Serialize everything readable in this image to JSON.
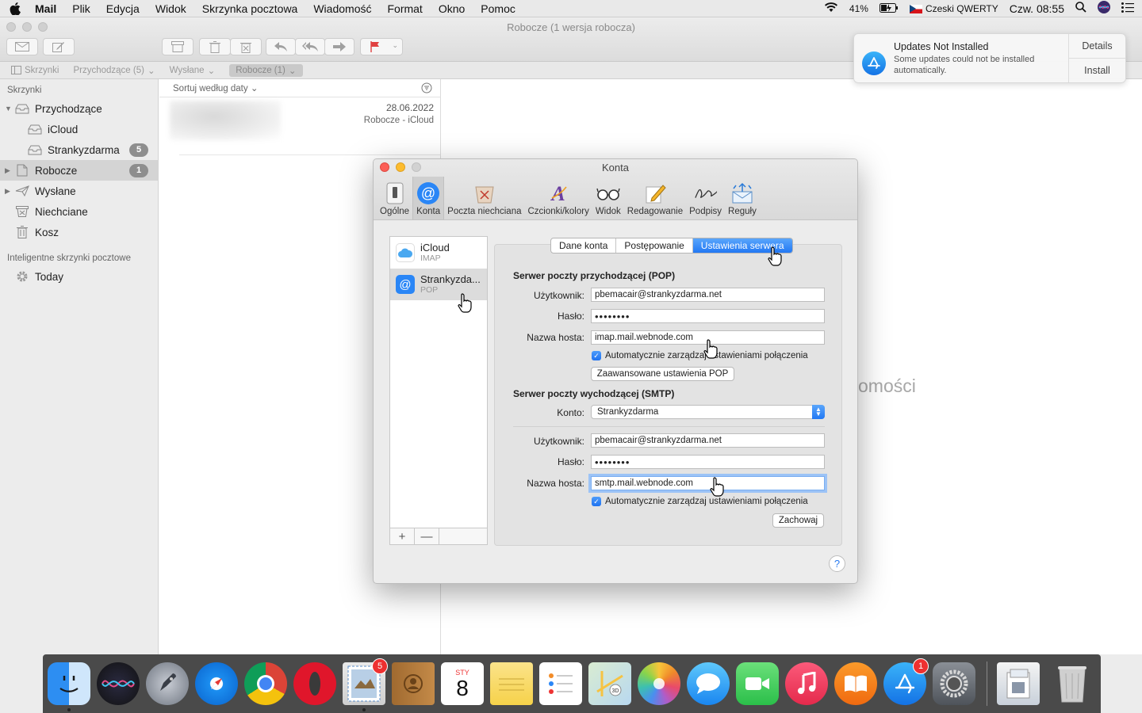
{
  "menubar": {
    "app": "Mail",
    "items": [
      "Plik",
      "Edycja",
      "Widok",
      "Skrzynka pocztowa",
      "Wiadomość",
      "Format",
      "Okno",
      "Pomoc"
    ],
    "battery": "41%",
    "input_source": "Czeski QWERTY",
    "clock": "Czw. 08:55"
  },
  "window": {
    "title": "Robocze (1 wersja robocza)"
  },
  "favorites": {
    "mailboxes": "Skrzynki",
    "inbox": "Przychodzące (5)",
    "sent": "Wysłane",
    "drafts": "Robocze (1)"
  },
  "sidebar": {
    "heading": "Skrzynki",
    "items": [
      {
        "label": "Przychodzące",
        "badge": ""
      },
      {
        "label": "iCloud",
        "badge": ""
      },
      {
        "label": "Strankyzdarma",
        "badge": "5"
      },
      {
        "label": "Robocze",
        "badge": "1"
      },
      {
        "label": "Wysłane",
        "badge": ""
      },
      {
        "label": "Niechciane",
        "badge": ""
      },
      {
        "label": "Kosz",
        "badge": ""
      }
    ],
    "smart_heading": "Inteligentne skrzynki pocztowe",
    "smart_items": [
      {
        "label": "Today"
      }
    ]
  },
  "message_list": {
    "sort_label": "Sortuj według daty",
    "messages": [
      {
        "date": "28.06.2022",
        "account": "Robocze - iCloud"
      }
    ]
  },
  "preview_hint": "omości",
  "notification": {
    "title": "Updates Not Installed",
    "text": "Some updates could not be installed automatically.",
    "details": "Details",
    "install": "Install"
  },
  "dialog": {
    "title": "Konta",
    "tools": [
      "Ogólne",
      "Konta",
      "Poczta niechciana",
      "Czcionki/kolory",
      "Widok",
      "Redagowanie",
      "Podpisy",
      "Reguły"
    ],
    "accounts": [
      {
        "name": "iCloud",
        "type": "IMAP"
      },
      {
        "name": "Strankyzda...",
        "type": "POP"
      }
    ],
    "add": "+",
    "remove": "—",
    "tabs": [
      "Dane konta",
      "Postępowanie",
      "Ustawienia serwera"
    ],
    "incoming": {
      "heading": "Serwer poczty przychodzącej (POP)",
      "user_label": "Użytkownik:",
      "user": "pbemacair@strankyzdarma.net",
      "pass_label": "Hasło:",
      "pass": "••••••••",
      "host_label": "Nazwa hosta:",
      "host": "imap.mail.webnode.com",
      "auto": "Automatycznie zarządzaj ustawieniami połączenia",
      "advanced": "Zaawansowane ustawienia POP"
    },
    "outgoing": {
      "heading": "Serwer poczty wychodzącej (SMTP)",
      "account_label": "Konto:",
      "account": "Strankyzdarma",
      "user_label": "Użytkownik:",
      "user": "pbemacair@strankyzdarma.net",
      "pass_label": "Hasło:",
      "pass": "••••••••",
      "host_label": "Nazwa hosta:",
      "host": "smtp.mail.webnode.com",
      "auto": "Automatycznie zarządzaj ustawieniami połączenia",
      "save": "Zachowaj"
    },
    "help": "?"
  },
  "dock": {
    "apps": [
      {
        "name": "Finder",
        "badge": ""
      },
      {
        "name": "Siri",
        "badge": ""
      },
      {
        "name": "Launchpad",
        "badge": ""
      },
      {
        "name": "Safari",
        "badge": ""
      },
      {
        "name": "Chrome",
        "badge": ""
      },
      {
        "name": "Opera",
        "badge": ""
      },
      {
        "name": "Mail",
        "badge": "5"
      },
      {
        "name": "Contacts",
        "badge": ""
      },
      {
        "name": "Calendar",
        "badge": ""
      },
      {
        "name": "Notes",
        "badge": ""
      },
      {
        "name": "Reminders",
        "badge": ""
      },
      {
        "name": "Maps",
        "badge": ""
      },
      {
        "name": "Photos",
        "badge": ""
      },
      {
        "name": "Messages",
        "badge": ""
      },
      {
        "name": "FaceTime",
        "badge": ""
      },
      {
        "name": "Music",
        "badge": ""
      },
      {
        "name": "Books",
        "badge": ""
      },
      {
        "name": "App Store",
        "badge": "1"
      },
      {
        "name": "System Preferences",
        "badge": ""
      }
    ],
    "calendar_month": "STY",
    "calendar_day": "8"
  },
  "colors": {
    "accent": "#2278f4",
    "badge": "#8e8e8e",
    "close": "#fc5f57",
    "minimize": "#fdbc2e",
    "zoom": "#d2d2d2"
  }
}
